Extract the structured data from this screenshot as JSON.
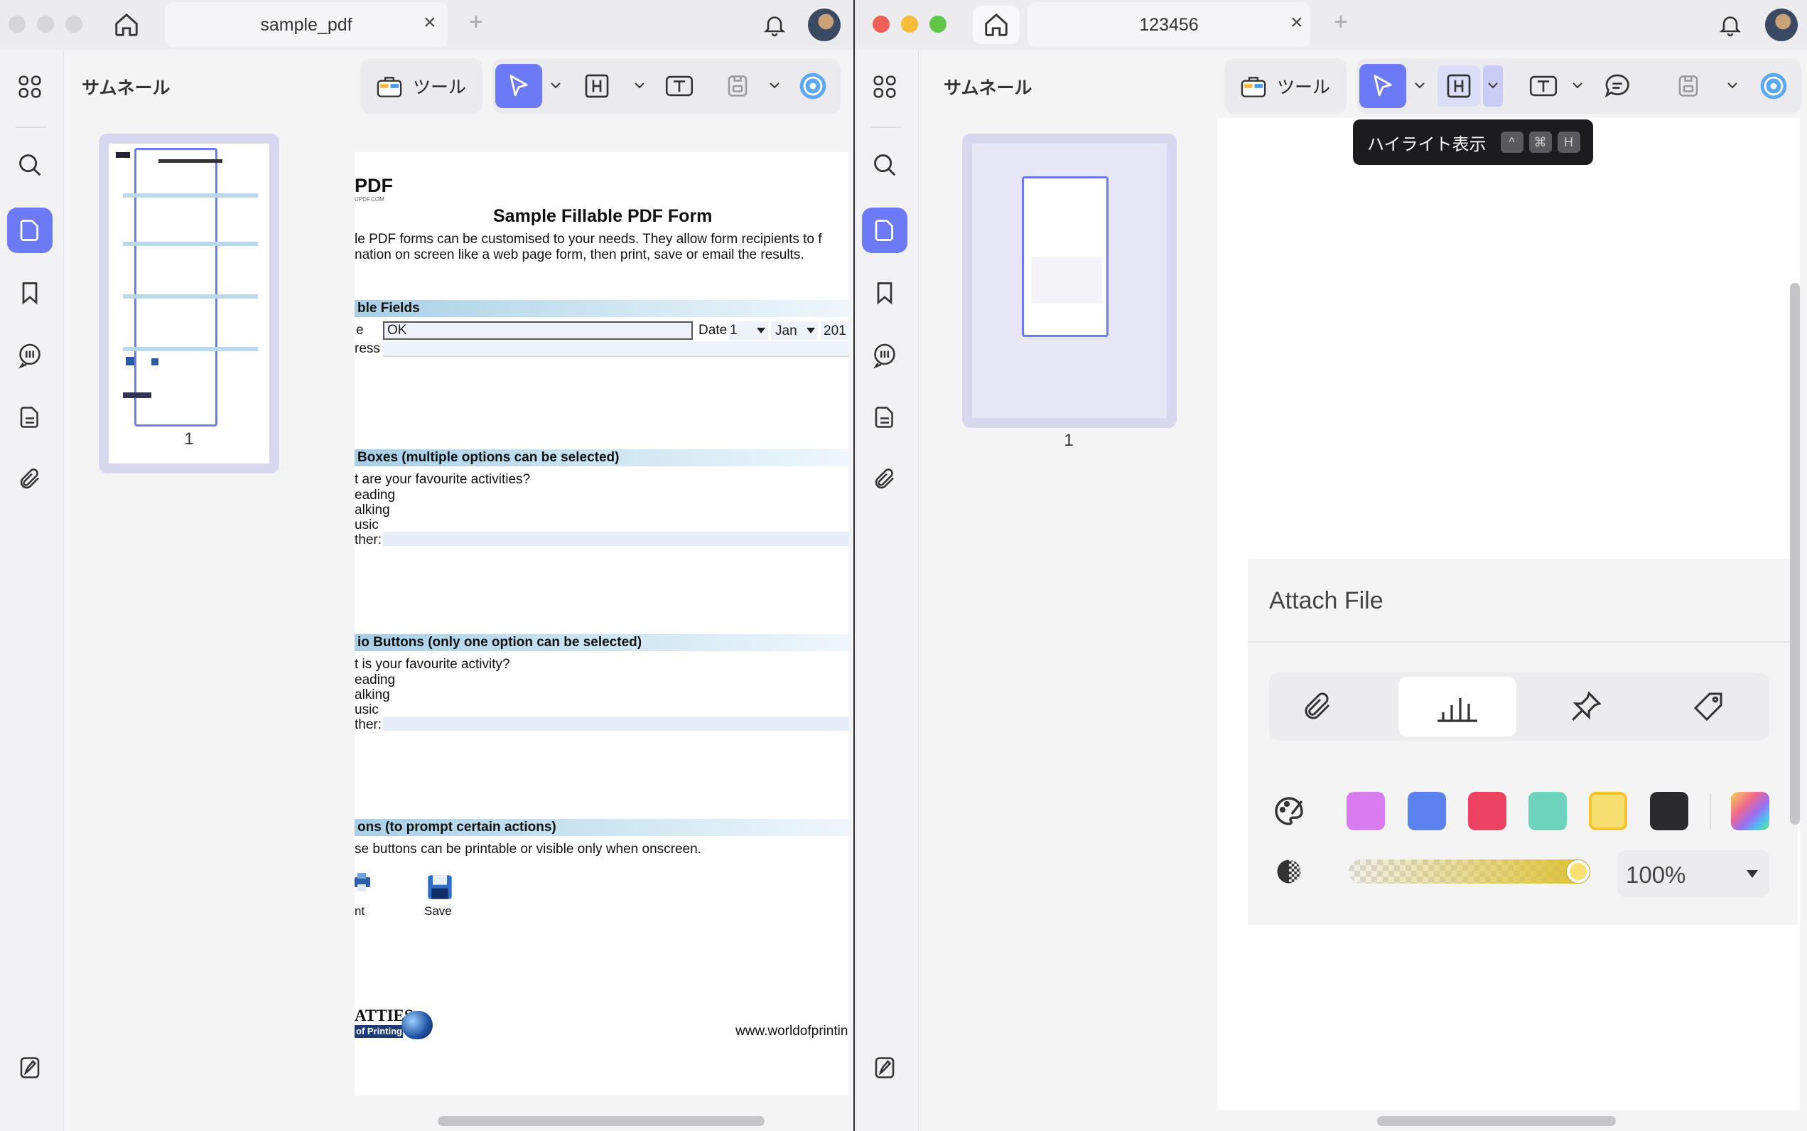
{
  "left_window": {
    "tab_title": "sample_pdf",
    "sidebar_title": "サムネール",
    "page_number": "1",
    "tools_label": "ツール",
    "pdf": {
      "brand": "PDF",
      "brand_url": "UPDF.COM",
      "title": "Sample Fillable PDF Form",
      "intro_line1": "le PDF forms can be customised to your needs. They allow form recipients to f",
      "intro_line2": "nation on screen like a web page form, then print, save or email the results.",
      "section_fields": "ble Fields",
      "name_label": "e",
      "name_value": "OK",
      "date_label": "Date",
      "date_day": "1",
      "date_month": "Jan",
      "date_year": "201",
      "address_label": "ress",
      "section_checkboxes": "Boxes (multiple options can be selected)",
      "cb_question": "t are your favourite activities?",
      "cb_options": [
        "eading",
        "alking",
        "usic",
        "ther:"
      ],
      "section_radio": "io Buttons (only one option can be selected)",
      "rb_question": "t is your favourite activity?",
      "rb_options": [
        "eading",
        "alking",
        "usic",
        "ther:"
      ],
      "section_buttons": "ons (to prompt certain actions)",
      "buttons_desc": "se buttons can be printable or visible only when onscreen.",
      "print_label": "nt",
      "save_label": "Save",
      "logo_line1": "ATTIES",
      "logo_line2": "of Printing",
      "footer_url": "www.worldofprintin"
    }
  },
  "right_window": {
    "tab_title": "123456",
    "sidebar_title": "サムネール",
    "page_number": "1",
    "tools_label": "ツール",
    "tooltip": {
      "label": "ハイライト表示",
      "keys": [
        "^",
        "⌘",
        "H"
      ]
    },
    "attach_panel": {
      "title": "Attach File",
      "icons": [
        "paperclip-icon",
        "graph-icon",
        "pushpin-icon",
        "tag-icon"
      ],
      "selected_icon": "graph-icon",
      "colors": [
        "#d97cf0",
        "#5b82ef",
        "#ec4363",
        "#6dd3bb",
        "#f8e070",
        "#2b2b2d"
      ],
      "selected_color": "#f8e070",
      "opacity_value": "100%",
      "opacity_level": 1.0
    }
  }
}
